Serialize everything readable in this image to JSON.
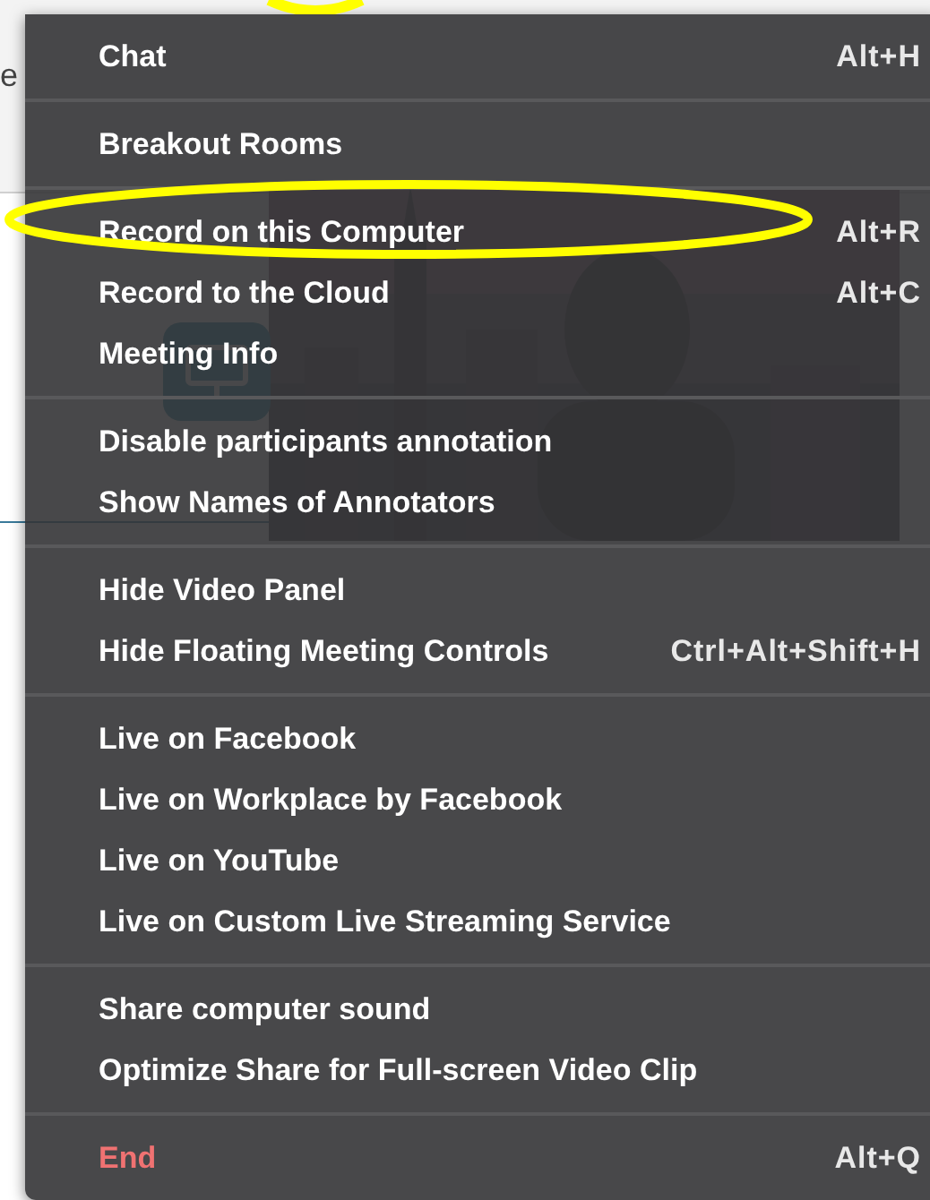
{
  "ribbon": {
    "groups": [
      {
        "lines": [
          "e"
        ]
      }
    ]
  },
  "menu": {
    "groups": [
      {
        "items": [
          {
            "label": "Chat",
            "shortcut": "Alt+H",
            "kind": "normal"
          }
        ]
      },
      {
        "items": [
          {
            "label": "Breakout Rooms",
            "kind": "normal"
          }
        ]
      },
      {
        "items": [
          {
            "label": "Record on this Computer",
            "shortcut": "Alt+R",
            "kind": "normal"
          },
          {
            "label": "Record to the Cloud",
            "shortcut": "Alt+C",
            "kind": "normal"
          },
          {
            "label": "Meeting Info",
            "kind": "normal"
          }
        ]
      },
      {
        "items": [
          {
            "label": "Disable participants annotation",
            "kind": "normal"
          },
          {
            "label": "Show Names of Annotators",
            "kind": "normal"
          }
        ]
      },
      {
        "items": [
          {
            "label": "Hide Video Panel",
            "kind": "normal"
          },
          {
            "label": "Hide Floating Meeting Controls",
            "shortcut": "Ctrl+Alt+Shift+H",
            "kind": "normal"
          }
        ]
      },
      {
        "items": [
          {
            "label": "Live on Facebook",
            "kind": "normal"
          },
          {
            "label": "Live on Workplace by Facebook",
            "kind": "normal"
          },
          {
            "label": "Live on YouTube",
            "kind": "normal"
          },
          {
            "label": "Live on Custom Live Streaming Service",
            "kind": "normal"
          }
        ]
      },
      {
        "items": [
          {
            "label": "Share computer sound",
            "kind": "normal"
          },
          {
            "label": "Optimize Share for Full-screen Video Clip",
            "kind": "normal"
          }
        ]
      },
      {
        "items": [
          {
            "label": "End",
            "shortcut": "Alt+Q",
            "kind": "danger"
          }
        ]
      }
    ]
  }
}
